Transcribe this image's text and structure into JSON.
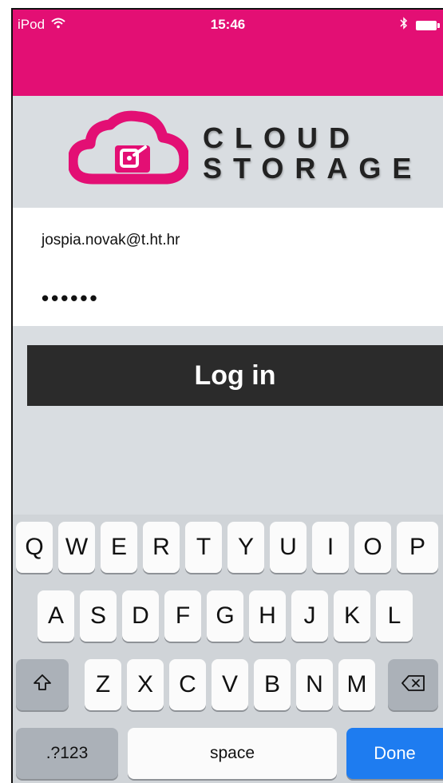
{
  "status_bar": {
    "device": "iPod",
    "time": "15:46"
  },
  "logo": {
    "line1": "CLOUD",
    "line2": "STORAGE",
    "accent_color": "#e30f74"
  },
  "form": {
    "email_value": "jospia.novak@t.ht.hr",
    "password_mask": "••••••",
    "login_label": "Log in"
  },
  "keyboard": {
    "row1": [
      "Q",
      "W",
      "E",
      "R",
      "T",
      "Y",
      "U",
      "I",
      "O",
      "P"
    ],
    "row2": [
      "A",
      "S",
      "D",
      "F",
      "G",
      "H",
      "J",
      "K",
      "L"
    ],
    "row3": [
      "Z",
      "X",
      "C",
      "V",
      "B",
      "N",
      "M"
    ],
    "shift_icon": "shift-icon",
    "backspace_icon": "backspace-icon",
    "numbers_label": ".?123",
    "space_label": "space",
    "done_label": "Done",
    "done_color": "#1e7cf0"
  }
}
